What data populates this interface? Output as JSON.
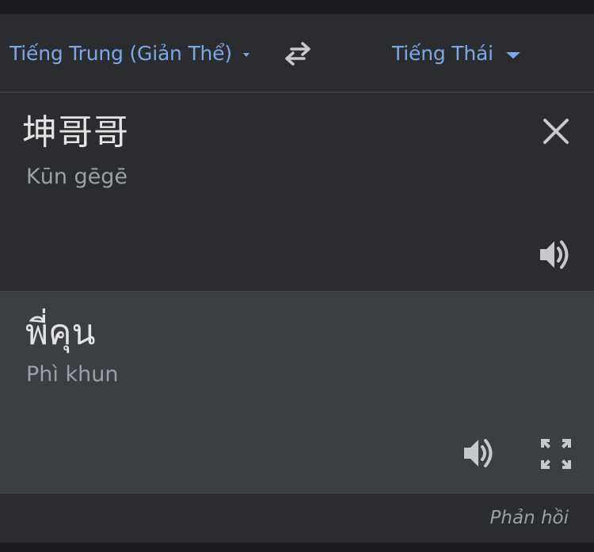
{
  "language_bar": {
    "source_language": "Tiếng Trung (Giản Thể)",
    "target_language": "Tiếng Thái",
    "accent_color": "#7ba8e6"
  },
  "source": {
    "text": "坤哥哥",
    "romanization": "Kūn gēgē"
  },
  "result": {
    "text": "พี่คุน",
    "romanization": "Phì khun"
  },
  "footer": {
    "feedback_label": "Phản hồi"
  },
  "icons": [
    "caret-down-icon",
    "swap-languages-icon",
    "close-icon",
    "speaker-icon",
    "fullscreen-icon"
  ],
  "colors": {
    "background": "#2b2c30",
    "result_background": "#3b3e42",
    "text_primary": "#e3e3e3",
    "text_secondary": "#9aa0a6",
    "icon": "#c6c8cc"
  }
}
